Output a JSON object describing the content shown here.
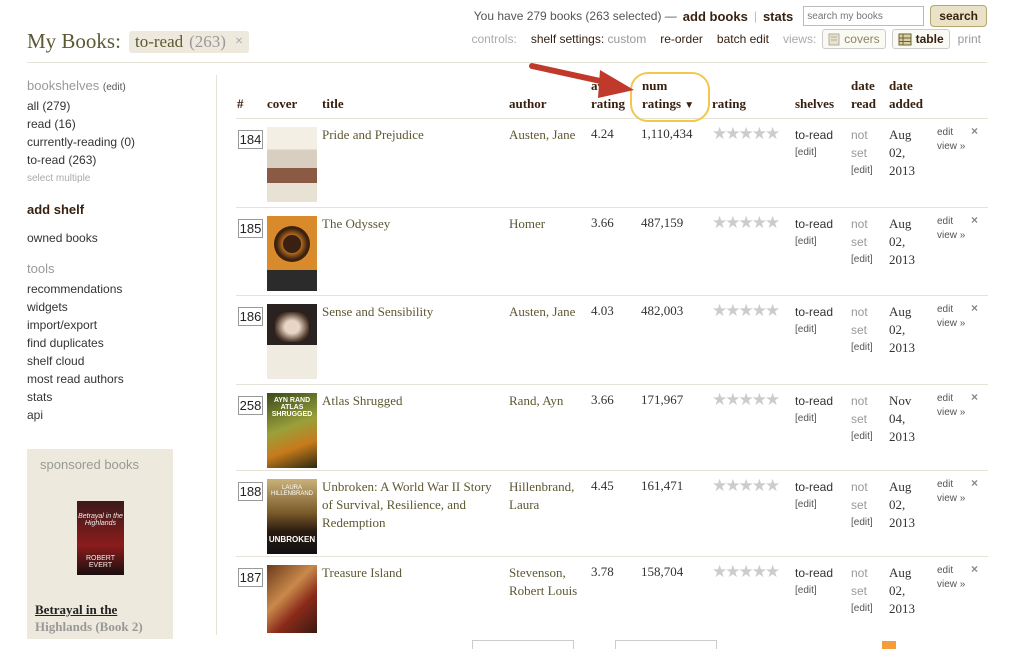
{
  "header": {
    "title": "My Books:",
    "shelf_chip": {
      "label": "to-read",
      "count": "(263)",
      "close": "×"
    },
    "summary": "You have 279 books (263 selected) —",
    "add_books": "add books",
    "separator": "|",
    "stats": "stats",
    "search_placeholder": "search my books",
    "search_button": "search"
  },
  "controls": {
    "label": "controls:",
    "shelf_settings_label": "shelf settings:",
    "shelf_settings_value": "custom",
    "reorder": "re-order",
    "batch_edit": "batch edit",
    "views_label": "views:",
    "covers": "covers",
    "table": "table",
    "print": "print"
  },
  "sidebar": {
    "bookshelves": "bookshelves",
    "bookshelves_edit": "(edit)",
    "shelves": [
      {
        "label": "all (279)"
      },
      {
        "label": "read (16)"
      },
      {
        "label": "currently-reading (0)"
      },
      {
        "label": "to-read (263)"
      }
    ],
    "select_multiple": "select multiple",
    "add_shelf": "add shelf",
    "owned_books": "owned books",
    "tools_heading": "tools",
    "tools": [
      {
        "label": "recommendations"
      },
      {
        "label": "widgets"
      },
      {
        "label": "import/export"
      },
      {
        "label": "find duplicates"
      },
      {
        "label": "shelf cloud"
      },
      {
        "label": "most read authors"
      },
      {
        "label": "stats"
      },
      {
        "label": "api"
      }
    ],
    "sponsored": {
      "heading": "sponsored books",
      "cover_text": "Betrayal in the Highlands",
      "cover_author": "ROBERT EVERT",
      "title": "Betrayal in the",
      "title_cont": "Highlands (Book 2)"
    }
  },
  "table": {
    "headers": {
      "num": "#",
      "cover": "cover",
      "title": "title",
      "author": "author",
      "avg_top": "avg",
      "avg_bottom": "rating",
      "num_top": "num",
      "num_bottom": "ratings",
      "rating": "rating",
      "shelves": "shelves",
      "date_read_top": "date",
      "date_read_bottom": "read",
      "date_added_top": "date",
      "date_added_bottom": "added"
    },
    "rows": [
      {
        "pos": "184",
        "title": "Pride and Prejudice",
        "author": "Austen, Jane",
        "avg": "4.24",
        "num": "1,110,434",
        "shelf": "to-read",
        "edit": "[edit]",
        "date_read_1": "not",
        "date_read_2": "set",
        "date_added_1": "Aug",
        "date_added_2": "02,",
        "date_added_3": "2013",
        "action_edit": "edit",
        "action_view": "view »",
        "remove": "×"
      },
      {
        "pos": "185",
        "title": "The Odyssey",
        "author": "Homer",
        "avg": "3.66",
        "num": "487,159",
        "shelf": "to-read",
        "edit": "[edit]",
        "date_read_1": "not",
        "date_read_2": "set",
        "date_added_1": "Aug",
        "date_added_2": "02,",
        "date_added_3": "2013",
        "action_edit": "edit",
        "action_view": "view »",
        "remove": "×"
      },
      {
        "pos": "186",
        "title": "Sense and Sensibility",
        "author": "Austen, Jane",
        "avg": "4.03",
        "num": "482,003",
        "shelf": "to-read",
        "edit": "[edit]",
        "date_read_1": "not",
        "date_read_2": "set",
        "date_added_1": "Aug",
        "date_added_2": "02,",
        "date_added_3": "2013",
        "action_edit": "edit",
        "action_view": "view »",
        "remove": "×"
      },
      {
        "pos": "258",
        "title": "Atlas Shrugged",
        "author": "Rand, Ayn",
        "avg": "3.66",
        "num": "171,967",
        "shelf": "to-read",
        "edit": "[edit]",
        "date_read_1": "not",
        "date_read_2": "set",
        "date_added_1": "Nov",
        "date_added_2": "04,",
        "date_added_3": "2013",
        "action_edit": "edit",
        "action_view": "view »",
        "remove": "×"
      },
      {
        "pos": "188",
        "title": "Unbroken: A World War II Story of Survival, Resilience, and Redemption",
        "author": "Hillenbrand, Laura",
        "avg": "4.45",
        "num": "161,471",
        "shelf": "to-read",
        "edit": "[edit]",
        "date_read_1": "not",
        "date_read_2": "set",
        "date_added_1": "Aug",
        "date_added_2": "02,",
        "date_added_3": "2013",
        "action_edit": "edit",
        "action_view": "view »",
        "remove": "×"
      },
      {
        "pos": "187",
        "title": "Treasure Island",
        "author": "Stevenson, Robert Louis",
        "avg": "3.78",
        "num": "158,704",
        "shelf": "to-read",
        "edit": "[edit]",
        "date_read_1": "not",
        "date_read_2": "set",
        "date_added_1": "Aug",
        "date_added_2": "02,",
        "date_added_3": "2013",
        "action_edit": "edit",
        "action_view": "view »",
        "remove": "×"
      }
    ],
    "stars": "★★★★★"
  },
  "covers": {
    "atlas_top": "AYN RAND",
    "atlas_mid": "ATLAS SHRUGGED",
    "unbroken_top": "LAURA HILLENBRAND",
    "unbroken_bottom": "UNBROKEN"
  },
  "colors": {
    "brand_brown": "#382110",
    "title_olive": "#5c5832",
    "highlight": "#f2c74c",
    "arrow": "#c0392b"
  }
}
